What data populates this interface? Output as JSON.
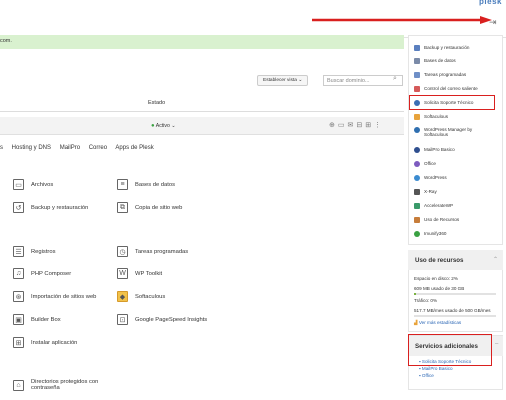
{
  "header": {
    "brand": "plesk"
  },
  "notice": {
    "text": "com."
  },
  "toolbar": {
    "set_view_label": "Establecer vista",
    "search_placeholder": "Buscar dominio..."
  },
  "list": {
    "status_header": "Estado",
    "status_value": "Activo"
  },
  "tabs": [
    "s",
    "Hosting y DNS",
    "MailPro",
    "Correo",
    "Apps de Plesk"
  ],
  "tools": [
    {
      "label": "Archivos",
      "icon": "folder-icon"
    },
    {
      "label": "Bases de datos",
      "icon": "database-icon"
    },
    {
      "label": "Backup y restauración",
      "icon": "backup-icon"
    },
    {
      "label": "Copia de sitio web",
      "icon": "copy-icon"
    },
    {
      "label": "Registros",
      "icon": "logs-icon"
    },
    {
      "label": "Tareas programadas",
      "icon": "scheduled-tasks-icon"
    },
    {
      "label": "PHP Composer",
      "icon": "composer-icon"
    },
    {
      "label": "WP Toolkit",
      "icon": "wordpress-icon"
    },
    {
      "label": "Importación de sitios web",
      "icon": "import-icon"
    },
    {
      "label": "Softaculous",
      "icon": "softaculous-icon"
    },
    {
      "label": "Builder Box",
      "icon": "builder-icon"
    },
    {
      "label": "Google PageSpeed Insights",
      "icon": "pagespeed-icon"
    },
    {
      "label": "Instalar aplicación",
      "icon": "apps-icon"
    },
    {
      "label": "Directorios protegidos con contraseña",
      "icon": "protected-dir-icon"
    }
  ],
  "sidebar": {
    "items": [
      {
        "label": "Backup y restauración",
        "color": "#5a7fbf"
      },
      {
        "label": "Bases de datos",
        "color": "#7a8aa8"
      },
      {
        "label": "Tareas programadas",
        "color": "#6f8fc7"
      },
      {
        "label": "Control del correo saliente",
        "color": "#d55a5a"
      },
      {
        "label": "Solicita Soporte Técnico",
        "color": "#3b6fb5"
      },
      {
        "label": "Softaculous",
        "color": "#e8a33b"
      },
      {
        "label": "WordPress Manager by Softaculous",
        "color": "#2f6fb0"
      },
      {
        "label": "MailPro Basico",
        "color": "#2f4f8f"
      },
      {
        "label": "Office",
        "color": "#7d5bbf"
      },
      {
        "label": "WordPress",
        "color": "#3b8bd0"
      },
      {
        "label": "X-Ray",
        "color": "#555555"
      },
      {
        "label": "AccelerateWP",
        "color": "#3a9a6a"
      },
      {
        "label": "Uso de Recursos",
        "color": "#c77d3a"
      },
      {
        "label": "Imunify360",
        "color": "#3aa142"
      }
    ]
  },
  "usage": {
    "title": "Uso de recursos",
    "disk_label": "Espacio en disco: 2%",
    "disk_detail": "609 MB usado de 30 GB",
    "disk_fraction": 0.02,
    "traffic_label": "Tráfico: 0%",
    "traffic_detail": "517.7 MB/mes usado de 500 GB/mes",
    "traffic_fraction": 0.0,
    "more_link": "Ver más estadísticas"
  },
  "services": {
    "title": "Servicios adicionales",
    "links": [
      "Solicita Soporte Técnico",
      "MailPro Basico",
      "Office"
    ]
  },
  "colors": {
    "accent": "#2a66b5",
    "notice_bg": "#d9f1cf",
    "highlight": "#d9201f",
    "active": "#3aa142"
  }
}
